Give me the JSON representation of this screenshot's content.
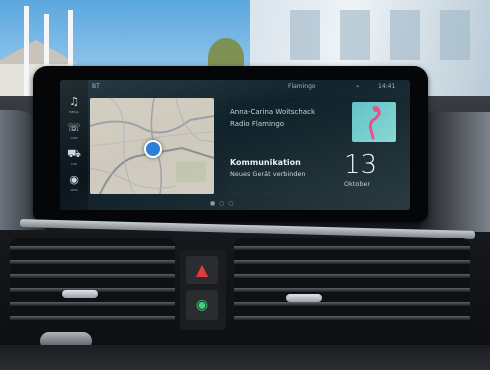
{
  "screen": {
    "topbar": {
      "left_text": "BT",
      "center_text": "Flamingo",
      "time": "14:41"
    },
    "sidebar": [
      {
        "icon": "music-icon",
        "glyph": "♫",
        "label": "MEDIA"
      },
      {
        "icon": "communication-icon",
        "glyph": "☏",
        "label": "COM"
      },
      {
        "icon": "car-icon",
        "glyph": "⛟",
        "label": "CAR"
      },
      {
        "icon": "apps-icon",
        "glyph": "◉",
        "label": "APPS"
      }
    ],
    "media": {
      "song": "Anna-Carina Woitschack",
      "station": "Radio Flamingo"
    },
    "communication": {
      "title": "Kommunikation",
      "subtitle": "Neues Gerät verbinden",
      "day": "13",
      "month": "Oktober"
    }
  },
  "colors": {
    "hazard": "#e03a3a",
    "dsc": "#3fd17c",
    "flamingo": "#e84a88"
  },
  "icons": {
    "hazard": "hazard-icon",
    "dsc": "dsc-icon"
  }
}
